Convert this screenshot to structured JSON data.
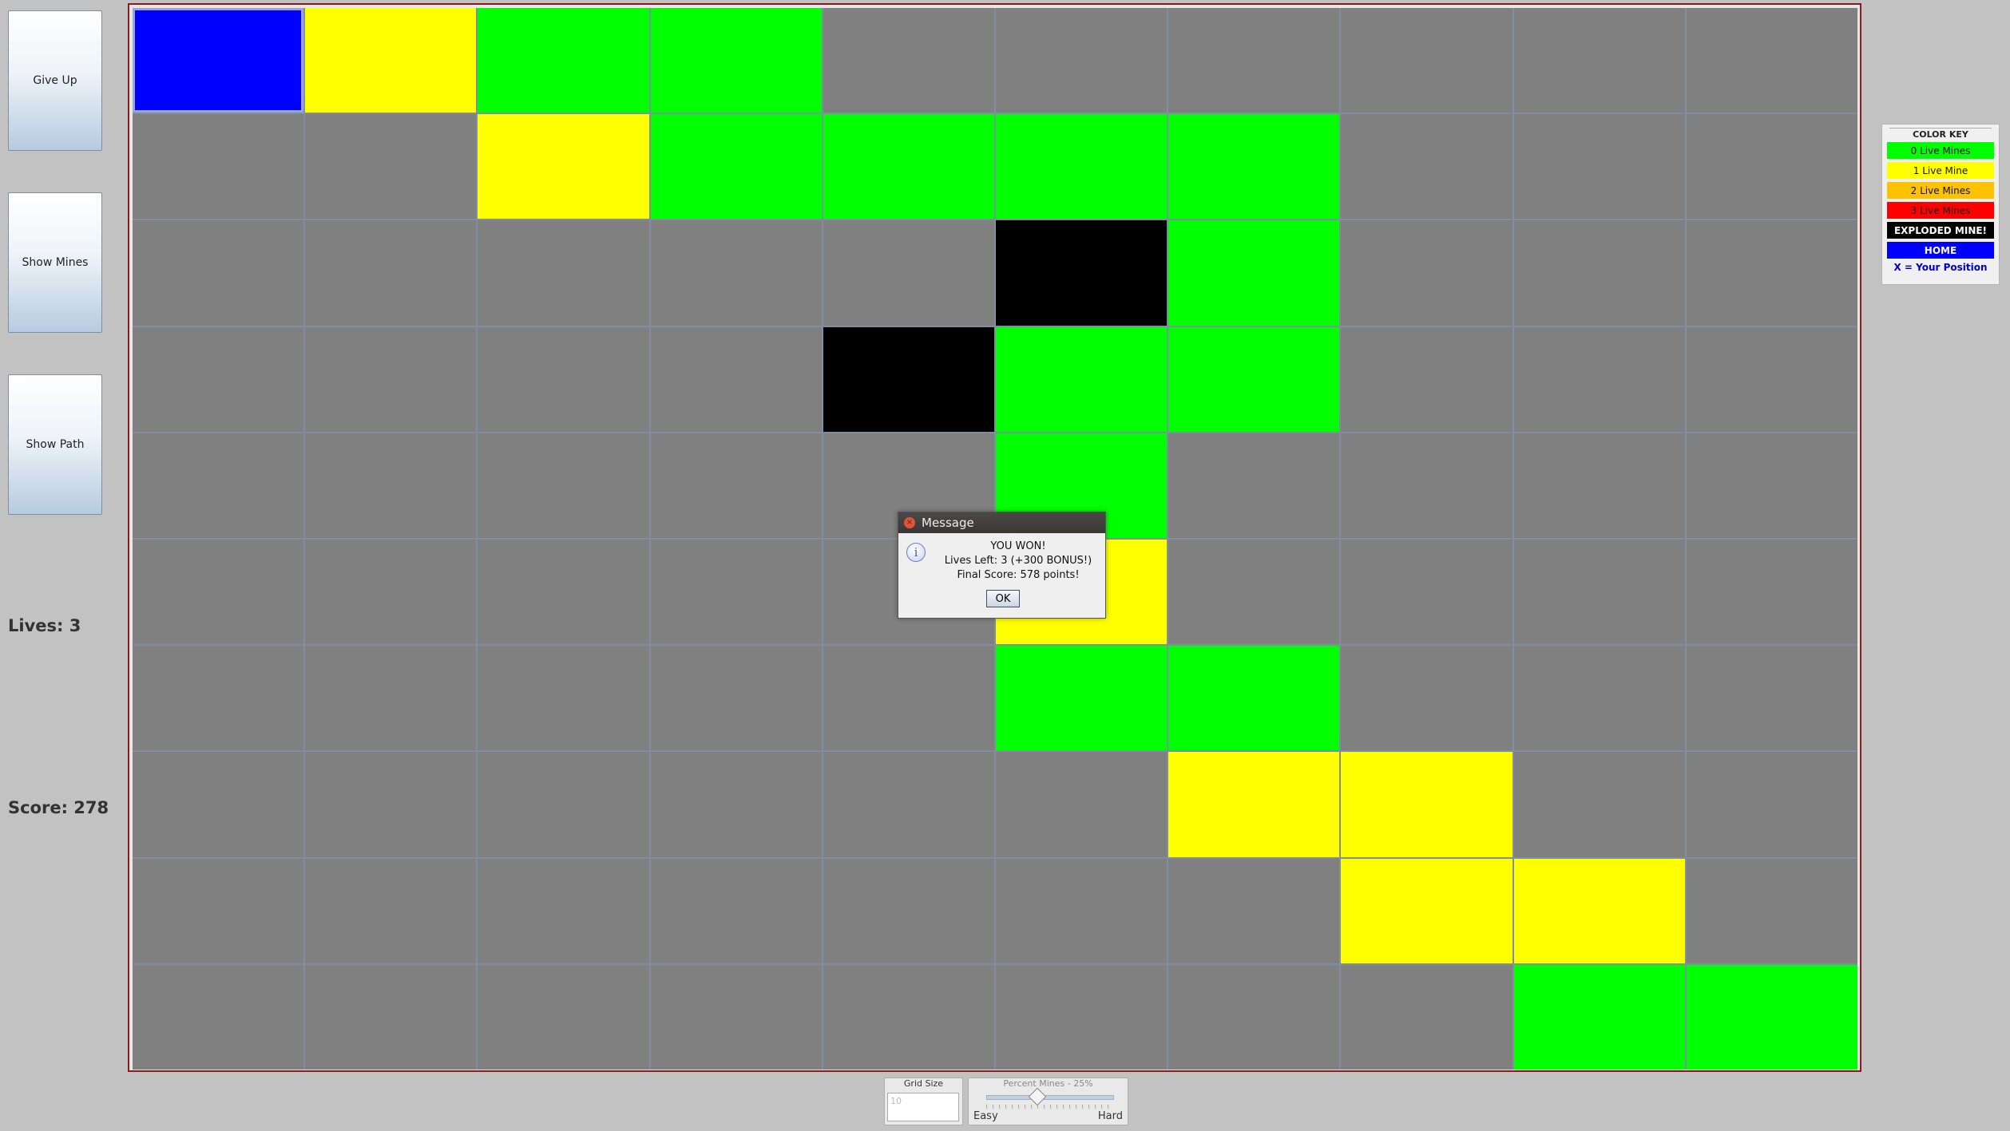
{
  "controls": {
    "give_up": "Give Up",
    "show_mines": "Show Mines",
    "show_path": "Show Path"
  },
  "stats": {
    "lives": "Lives: 3",
    "score": "Score: 278"
  },
  "board": {
    "rows": 10,
    "cols": 10,
    "cells": [
      [
        "home",
        "one",
        "zero",
        "zero",
        "none",
        "none",
        "none",
        "none",
        "none",
        "none"
      ],
      [
        "none",
        "none",
        "one",
        "zero",
        "zero",
        "zero",
        "zero",
        "none",
        "none",
        "none"
      ],
      [
        "none",
        "none",
        "none",
        "none",
        "none",
        "exploded",
        "zero",
        "none",
        "none",
        "none"
      ],
      [
        "none",
        "none",
        "none",
        "none",
        "exploded",
        "zero",
        "zero",
        "none",
        "none",
        "none"
      ],
      [
        "none",
        "none",
        "none",
        "none",
        "none",
        "zero",
        "none",
        "none",
        "none",
        "none"
      ],
      [
        "none",
        "none",
        "none",
        "none",
        "none",
        "one",
        "none",
        "none",
        "none",
        "none"
      ],
      [
        "none",
        "none",
        "none",
        "none",
        "none",
        "zero",
        "zero",
        "none",
        "none",
        "none"
      ],
      [
        "none",
        "none",
        "none",
        "none",
        "none",
        "none",
        "one",
        "one",
        "none",
        "none"
      ],
      [
        "none",
        "none",
        "none",
        "none",
        "none",
        "none",
        "none",
        "one",
        "one",
        "none"
      ],
      [
        "none",
        "none",
        "none",
        "none",
        "none",
        "none",
        "none",
        "none",
        "zero",
        "zero"
      ]
    ]
  },
  "colors": {
    "none": "#808080",
    "zero": "#00ff00",
    "one": "#ffff00",
    "two": "#ffc200",
    "three": "#ff0000",
    "exploded": "#000000",
    "home": "#0000ff"
  },
  "color_key": {
    "title": "COLOR KEY",
    "items": [
      {
        "label": "0 Live Mines",
        "bg": "#00ff00",
        "fg": "#111111"
      },
      {
        "label": "1 Live Mine",
        "bg": "#ffff00",
        "fg": "#111111"
      },
      {
        "label": "2 Live Mines",
        "bg": "#ffc200",
        "fg": "#111111"
      },
      {
        "label": "3 Live Mines",
        "bg": "#ff0000",
        "fg": "#111111"
      },
      {
        "label": "EXPLODED MINE!",
        "bg": "#000000",
        "fg": "#ffffff"
      },
      {
        "label": "HOME",
        "bg": "#0000ff",
        "fg": "#ffffff"
      }
    ],
    "position_note": "X = Your Position"
  },
  "dialog": {
    "title": "Message",
    "line1": "YOU WON!",
    "line2": "Lives Left: 3 (+300 BONUS!)",
    "line3": "Final Score: 578 points!",
    "ok": "OK"
  },
  "settings": {
    "grid_size_title": "Grid Size",
    "grid_size_value": "10",
    "percent_mines_title": "Percent Mines - 25%",
    "percent_mines_value": 25,
    "easy": "Easy",
    "hard": "Hard"
  }
}
